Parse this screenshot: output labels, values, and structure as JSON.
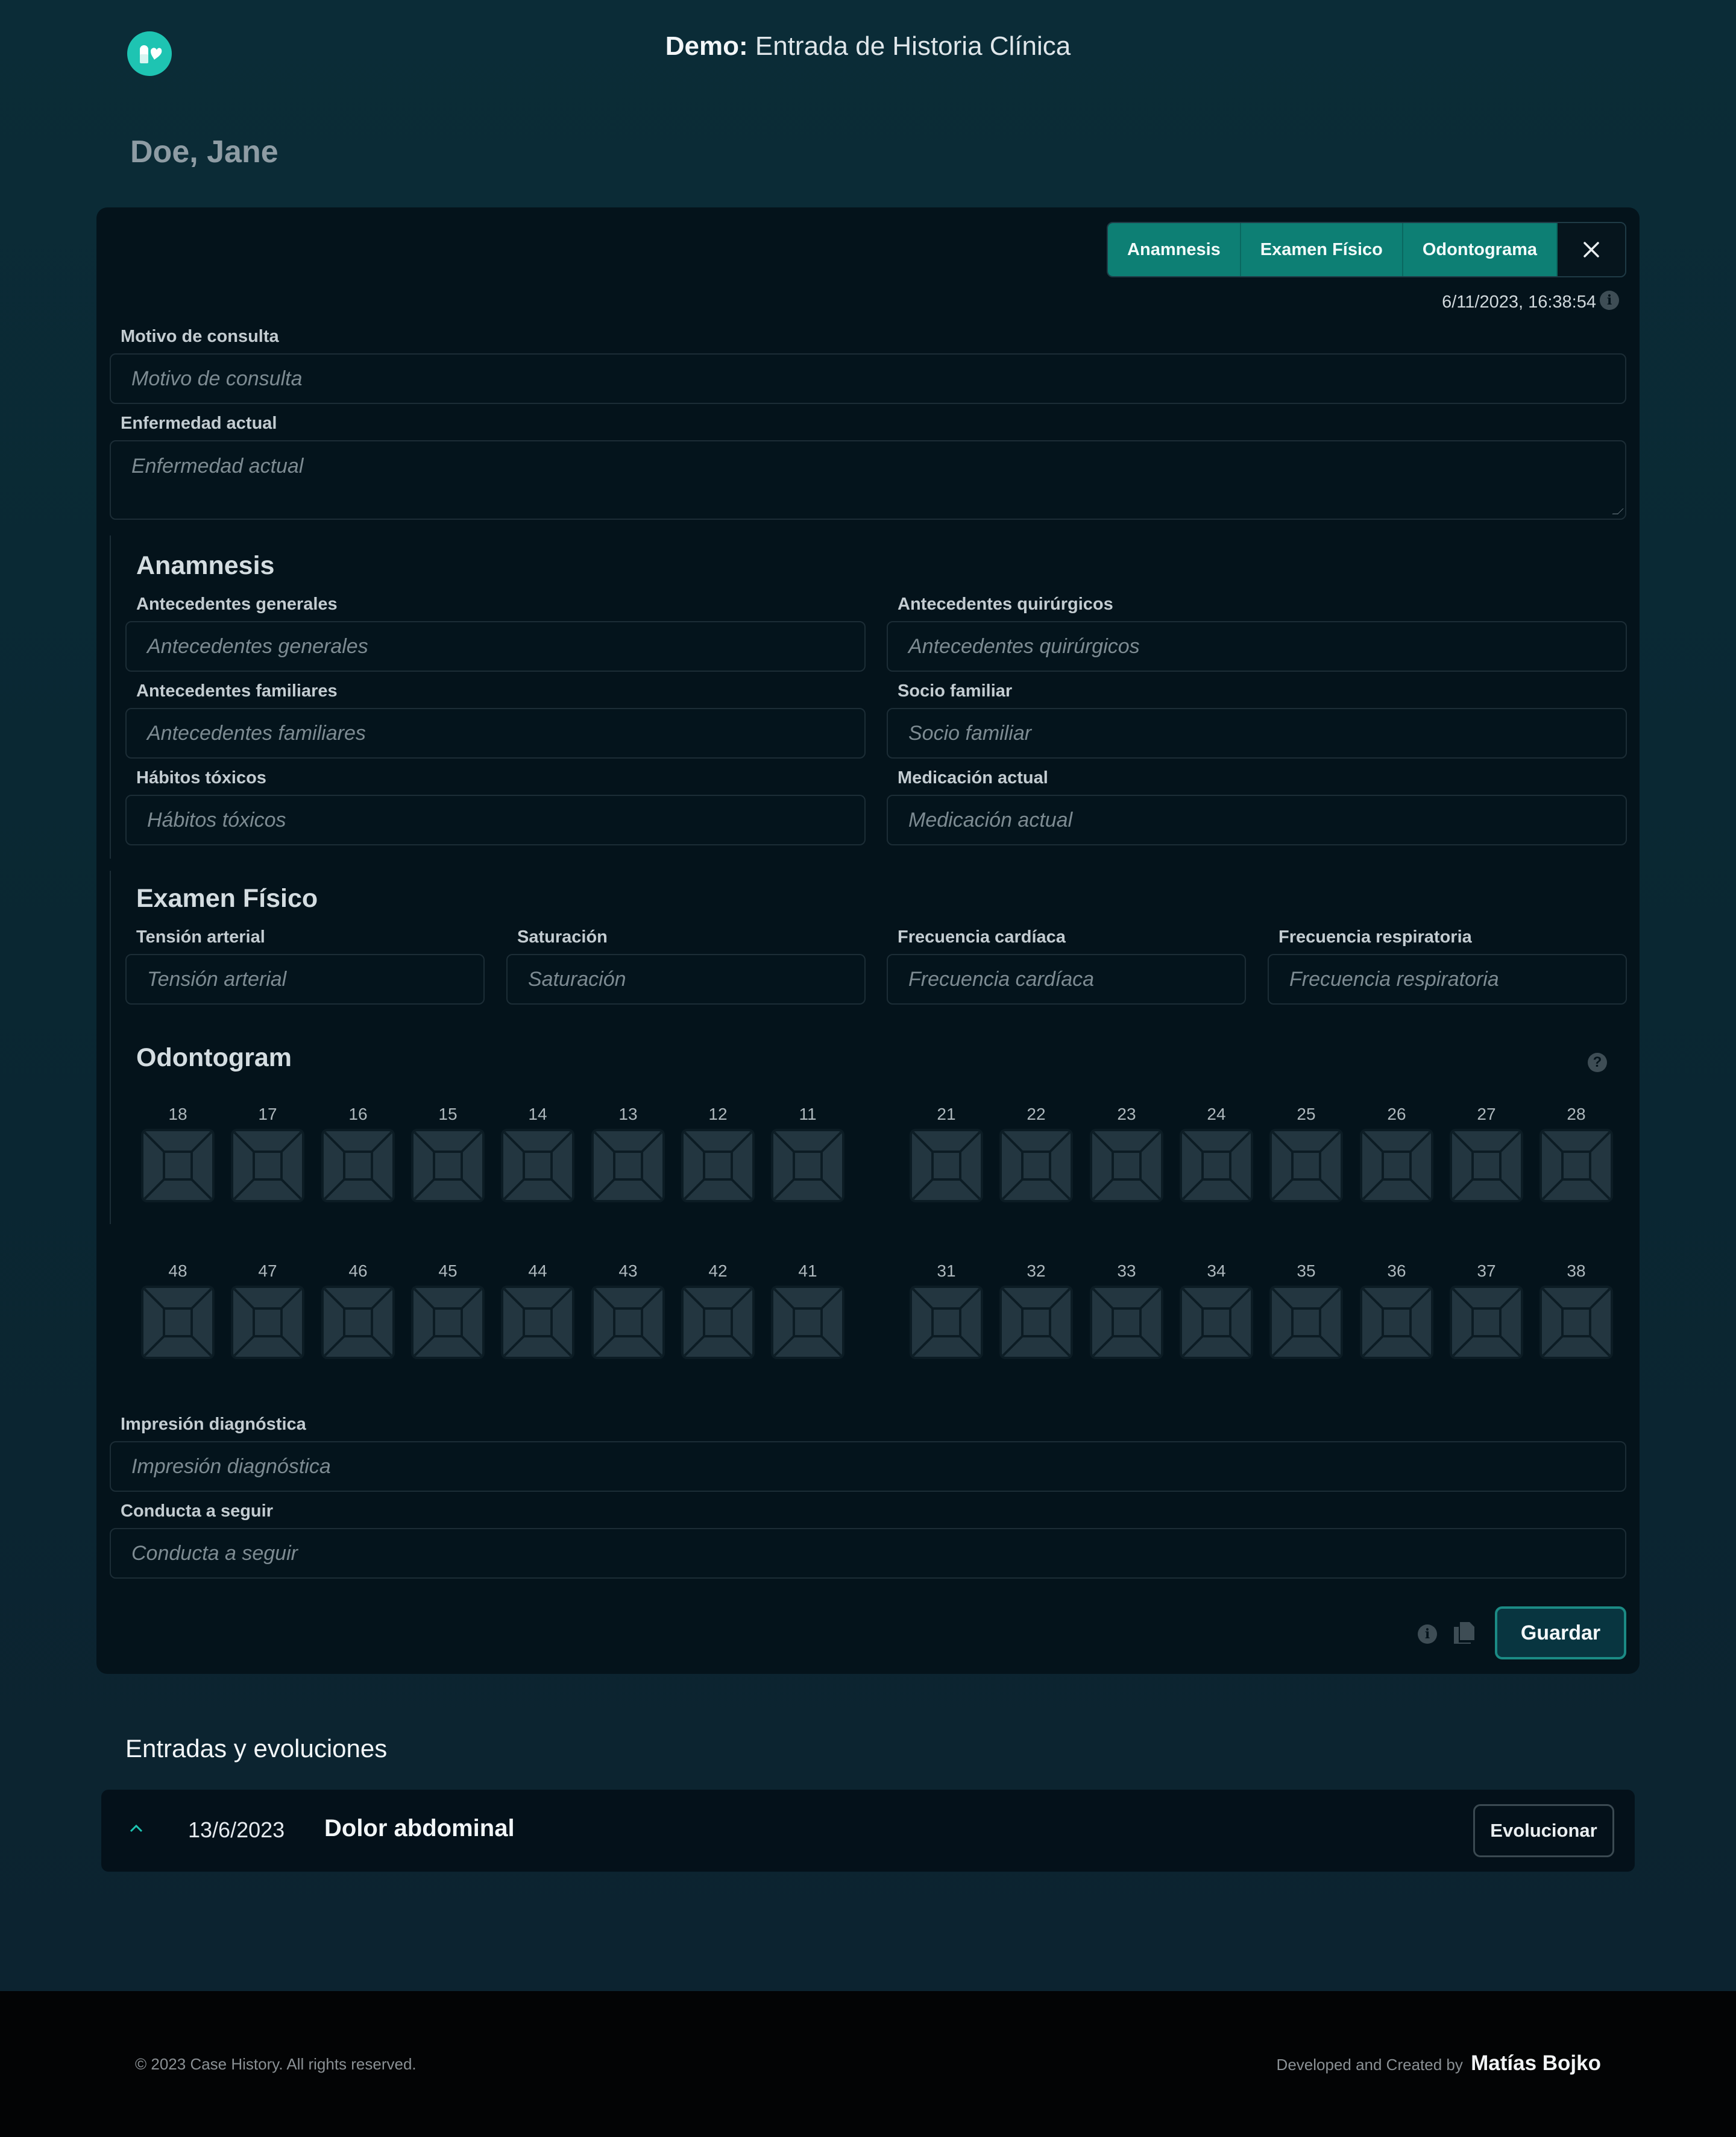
{
  "app": {
    "title_bold": "Demo:",
    "title_light": "Entrada de Historia Clínica",
    "logo_icon": "pills-icon",
    "accent": "#1ec4b2"
  },
  "patient": {
    "name": "Doe, Jane"
  },
  "tabs": [
    {
      "label": "Anamnesis"
    },
    {
      "label": "Examen Físico"
    },
    {
      "label": "Odontograma"
    }
  ],
  "timestamp": "6/11/2023, 16:38:54",
  "fields": {
    "motivo": {
      "label": "Motivo de consulta",
      "placeholder": "Motivo de consulta"
    },
    "enfermedad": {
      "label": "Enfermedad actual",
      "placeholder": "Enfermedad actual"
    },
    "diagnostico": {
      "label": "Impresión diagnóstica",
      "placeholder": "Impresión diagnóstica"
    },
    "conducta": {
      "label": "Conducta a seguir",
      "placeholder": "Conducta a seguir"
    }
  },
  "anamnesis": {
    "title": "Anamnesis",
    "fields": [
      {
        "label": "Antecedentes generales",
        "placeholder": "Antecedentes generales"
      },
      {
        "label": "Antecedentes quirúrgicos",
        "placeholder": "Antecedentes quirúrgicos"
      },
      {
        "label": "Antecedentes familiares",
        "placeholder": "Antecedentes familiares"
      },
      {
        "label": "Socio familiar",
        "placeholder": "Socio familiar"
      },
      {
        "label": "Hábitos tóxicos",
        "placeholder": "Hábitos tóxicos"
      },
      {
        "label": "Medicación actual",
        "placeholder": "Medicación actual"
      }
    ]
  },
  "examen": {
    "title": "Examen Físico",
    "fields": [
      {
        "label": "Tensión arterial",
        "placeholder": "Tensión arterial"
      },
      {
        "label": "Saturación",
        "placeholder": "Saturación"
      },
      {
        "label": "Frecuencia cardíaca",
        "placeholder": "Frecuencia cardíaca"
      },
      {
        "label": "Frecuencia respiratoria",
        "placeholder": "Frecuencia respiratoria"
      }
    ]
  },
  "odontogram": {
    "title": "Odontogram",
    "upper": [
      "18",
      "17",
      "16",
      "15",
      "14",
      "13",
      "12",
      "11",
      "21",
      "22",
      "23",
      "24",
      "25",
      "26",
      "27",
      "28"
    ],
    "lower": [
      "48",
      "47",
      "46",
      "45",
      "44",
      "43",
      "42",
      "41",
      "31",
      "32",
      "33",
      "34",
      "35",
      "36",
      "37",
      "38"
    ]
  },
  "actions": {
    "save_label": "Guardar"
  },
  "entries": {
    "title": "Entradas y evoluciones",
    "items": [
      {
        "date": "13/6/2023",
        "title": "Dolor abdominal",
        "action": "Evolucionar"
      }
    ]
  },
  "footer": {
    "copyright": "© 2023 Case History. All rights reserved.",
    "credit_prefix": "Developed and Created by",
    "author": "Matías Bojko"
  }
}
